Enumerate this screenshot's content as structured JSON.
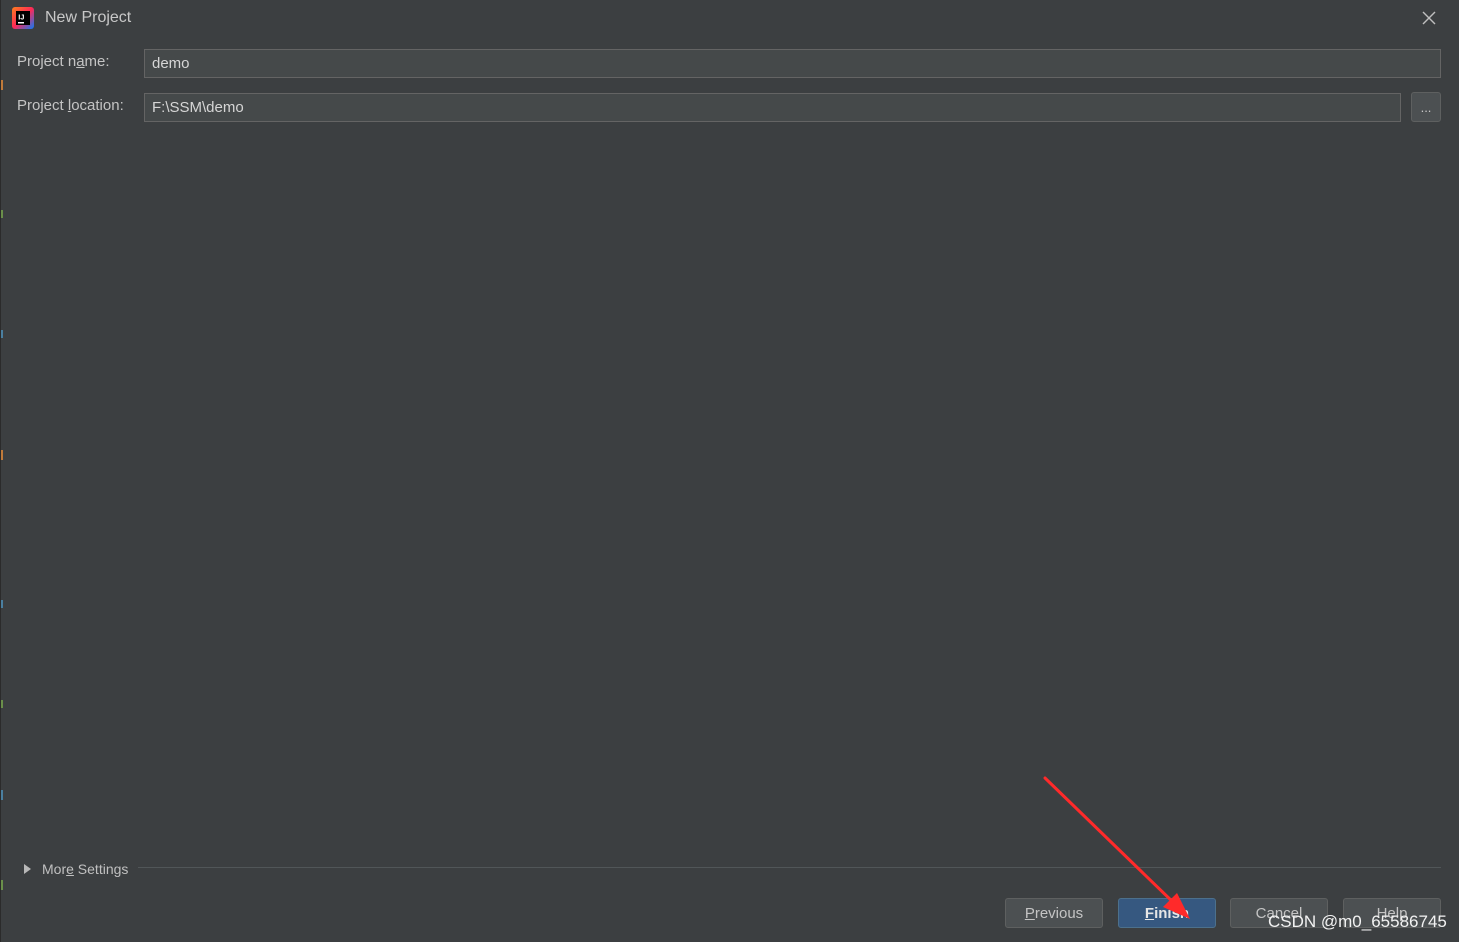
{
  "window": {
    "title": "New Project"
  },
  "form": {
    "project_name": {
      "label_pre": "Project n",
      "label_mnemonic": "a",
      "label_post": "me:",
      "value": "demo"
    },
    "project_location": {
      "label_pre": "Project ",
      "label_mnemonic": "l",
      "label_post": "ocation:",
      "value": "F:\\SSM\\demo"
    },
    "browse_label": "..."
  },
  "more_settings": {
    "label_pre": "Mor",
    "label_mnemonic": "e",
    "label_post": " Settings"
  },
  "buttons": {
    "previous": {
      "mnemonic": "P",
      "rest": "revious"
    },
    "finish": {
      "mnemonic": "F",
      "rest": "inish"
    },
    "cancel": "Cancel",
    "help": "Help"
  },
  "watermark": "CSDN @m0_65586745",
  "colors": {
    "background": "#3c3f41",
    "input_bg": "#45494a",
    "primary_button": "#365880",
    "annotation_arrow": "#ff2a2a"
  },
  "icons": {
    "app": "intellij-idea-icon",
    "close": "close-icon",
    "expand": "triangle-right-icon"
  }
}
